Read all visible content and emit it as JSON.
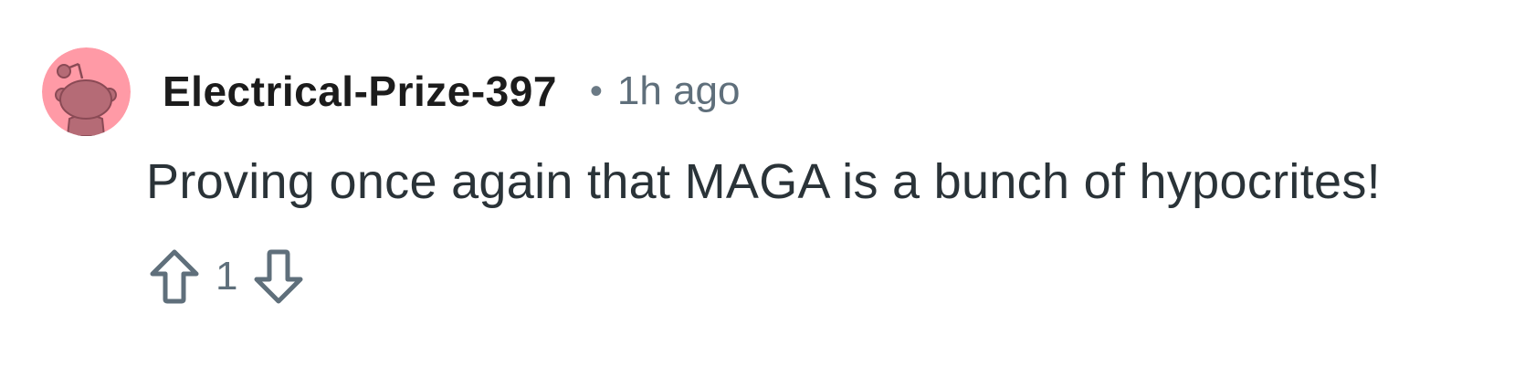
{
  "comment": {
    "author": "Electrical-Prize-397",
    "separator": "•",
    "timestamp": "1h ago",
    "text": "Proving once again that MAGA is a bunch of hypocrites!",
    "score": "1"
  },
  "avatar": {
    "icon": "reddit-snoo-avatar-icon",
    "background_color": "#ff9aa6",
    "figure_color": "#b56b76"
  },
  "icons": {
    "upvote": "upvote-arrow-icon",
    "downvote": "downvote-arrow-icon"
  },
  "colors": {
    "author_text": "#1c1c1c",
    "meta_text": "#5f6f7b",
    "body_text": "#2a3338"
  }
}
